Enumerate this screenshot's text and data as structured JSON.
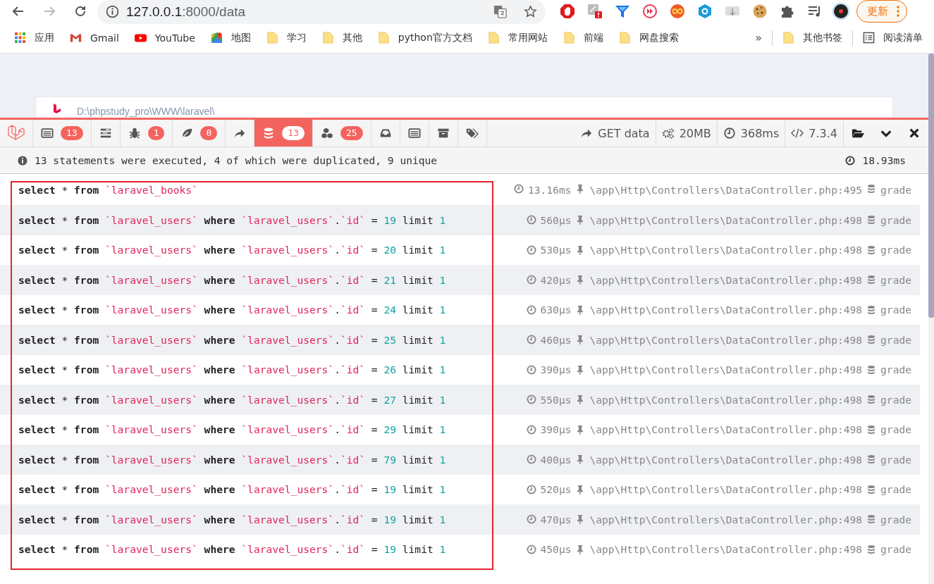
{
  "browser": {
    "navigation": {
      "forward_disabled": true
    },
    "address": {
      "host": "127.0.0.1",
      "path": ":8000/data"
    },
    "update_button": "更新",
    "bookmarks": [
      {
        "kind": "apps",
        "label": "应用"
      },
      {
        "kind": "gmail",
        "label": "Gmail"
      },
      {
        "kind": "youtube",
        "label": "YouTube"
      },
      {
        "kind": "maps",
        "label": "地图"
      },
      {
        "kind": "folder",
        "label": "学习"
      },
      {
        "kind": "folder",
        "label": "其他"
      },
      {
        "kind": "folder",
        "label": "python官方文档"
      },
      {
        "kind": "folder",
        "label": "常用网站"
      },
      {
        "kind": "folder",
        "label": "前端"
      },
      {
        "kind": "folder",
        "label": "网盘搜索"
      }
    ],
    "overflow": "»",
    "other_bookmarks": "其他书签",
    "reading_list": "阅读清单"
  },
  "page": {
    "path": "D:\\phpstudy_pro\\WWW\\laravel\\"
  },
  "debugbar": {
    "tabs": [
      {
        "kind": "messages",
        "badge": "13",
        "selected": false
      },
      {
        "kind": "timeline",
        "selected": false
      },
      {
        "kind": "exceptions",
        "badge": "1",
        "selected": false
      },
      {
        "kind": "views",
        "badge": "0",
        "selected": false
      },
      {
        "kind": "route",
        "selected": false
      },
      {
        "kind": "queries",
        "badge": "13",
        "selected": true
      },
      {
        "kind": "models",
        "badge": "25",
        "selected": false
      },
      {
        "kind": "mails",
        "selected": false
      },
      {
        "kind": "request",
        "selected": false
      },
      {
        "kind": "session",
        "selected": false
      },
      {
        "kind": "tags",
        "selected": false
      }
    ],
    "indicators": [
      {
        "kind": "route",
        "text": "GET data"
      },
      {
        "kind": "memory",
        "text": "20MB"
      },
      {
        "kind": "time",
        "text": "368ms"
      },
      {
        "kind": "php",
        "text": "7.3.4"
      }
    ],
    "controls": [
      {
        "kind": "open"
      },
      {
        "kind": "minimize"
      },
      {
        "kind": "close"
      }
    ],
    "summary": "13 statements were executed, 4 of which were duplicated, 9 unique",
    "total_time": "18.93ms",
    "statements": [
      {
        "sql": [
          {
            "kind": "keyword",
            "text": "select"
          },
          {
            "kind": "plain",
            "text": " * "
          },
          {
            "kind": "keyword",
            "text": "from "
          },
          {
            "kind": "string",
            "text": "`laravel_books`"
          }
        ],
        "duration": "13.16ms",
        "source": "\\app\\Http\\Controllers\\DataController.php:495",
        "connection": "grade"
      },
      {
        "sql": [
          {
            "kind": "keyword",
            "text": "select"
          },
          {
            "kind": "plain",
            "text": " * "
          },
          {
            "kind": "keyword",
            "text": "from "
          },
          {
            "kind": "string",
            "text": "`laravel_users`"
          },
          {
            "kind": "keyword",
            "text": " where "
          },
          {
            "kind": "string",
            "text": "`laravel_users`"
          },
          {
            "kind": "plain",
            "text": "."
          },
          {
            "kind": "string",
            "text": "`id`"
          },
          {
            "kind": "plain",
            "text": " = "
          },
          {
            "kind": "number",
            "text": "19"
          },
          {
            "kind": "plain",
            "text": " limit "
          },
          {
            "kind": "number",
            "text": "1"
          }
        ],
        "duration": "560μs",
        "source": "\\app\\Http\\Controllers\\DataController.php:498",
        "connection": "grade"
      },
      {
        "sql": [
          {
            "kind": "keyword",
            "text": "select"
          },
          {
            "kind": "plain",
            "text": " * "
          },
          {
            "kind": "keyword",
            "text": "from "
          },
          {
            "kind": "string",
            "text": "`laravel_users`"
          },
          {
            "kind": "keyword",
            "text": " where "
          },
          {
            "kind": "string",
            "text": "`laravel_users`"
          },
          {
            "kind": "plain",
            "text": "."
          },
          {
            "kind": "string",
            "text": "`id`"
          },
          {
            "kind": "plain",
            "text": " = "
          },
          {
            "kind": "number",
            "text": "20"
          },
          {
            "kind": "plain",
            "text": " limit "
          },
          {
            "kind": "number",
            "text": "1"
          }
        ],
        "duration": "530μs",
        "source": "\\app\\Http\\Controllers\\DataController.php:498",
        "connection": "grade"
      },
      {
        "sql": [
          {
            "kind": "keyword",
            "text": "select"
          },
          {
            "kind": "plain",
            "text": " * "
          },
          {
            "kind": "keyword",
            "text": "from "
          },
          {
            "kind": "string",
            "text": "`laravel_users`"
          },
          {
            "kind": "keyword",
            "text": " where "
          },
          {
            "kind": "string",
            "text": "`laravel_users`"
          },
          {
            "kind": "plain",
            "text": "."
          },
          {
            "kind": "string",
            "text": "`id`"
          },
          {
            "kind": "plain",
            "text": " = "
          },
          {
            "kind": "number",
            "text": "21"
          },
          {
            "kind": "plain",
            "text": " limit "
          },
          {
            "kind": "number",
            "text": "1"
          }
        ],
        "duration": "420μs",
        "source": "\\app\\Http\\Controllers\\DataController.php:498",
        "connection": "grade"
      },
      {
        "sql": [
          {
            "kind": "keyword",
            "text": "select"
          },
          {
            "kind": "plain",
            "text": " * "
          },
          {
            "kind": "keyword",
            "text": "from "
          },
          {
            "kind": "string",
            "text": "`laravel_users`"
          },
          {
            "kind": "keyword",
            "text": " where "
          },
          {
            "kind": "string",
            "text": "`laravel_users`"
          },
          {
            "kind": "plain",
            "text": "."
          },
          {
            "kind": "string",
            "text": "`id`"
          },
          {
            "kind": "plain",
            "text": " = "
          },
          {
            "kind": "number",
            "text": "24"
          },
          {
            "kind": "plain",
            "text": " limit "
          },
          {
            "kind": "number",
            "text": "1"
          }
        ],
        "duration": "630μs",
        "source": "\\app\\Http\\Controllers\\DataController.php:498",
        "connection": "grade"
      },
      {
        "sql": [
          {
            "kind": "keyword",
            "text": "select"
          },
          {
            "kind": "plain",
            "text": " * "
          },
          {
            "kind": "keyword",
            "text": "from "
          },
          {
            "kind": "string",
            "text": "`laravel_users`"
          },
          {
            "kind": "keyword",
            "text": " where "
          },
          {
            "kind": "string",
            "text": "`laravel_users`"
          },
          {
            "kind": "plain",
            "text": "."
          },
          {
            "kind": "string",
            "text": "`id`"
          },
          {
            "kind": "plain",
            "text": " = "
          },
          {
            "kind": "number",
            "text": "25"
          },
          {
            "kind": "plain",
            "text": " limit "
          },
          {
            "kind": "number",
            "text": "1"
          }
        ],
        "duration": "460μs",
        "source": "\\app\\Http\\Controllers\\DataController.php:498",
        "connection": "grade"
      },
      {
        "sql": [
          {
            "kind": "keyword",
            "text": "select"
          },
          {
            "kind": "plain",
            "text": " * "
          },
          {
            "kind": "keyword",
            "text": "from "
          },
          {
            "kind": "string",
            "text": "`laravel_users`"
          },
          {
            "kind": "keyword",
            "text": " where "
          },
          {
            "kind": "string",
            "text": "`laravel_users`"
          },
          {
            "kind": "plain",
            "text": "."
          },
          {
            "kind": "string",
            "text": "`id`"
          },
          {
            "kind": "plain",
            "text": " = "
          },
          {
            "kind": "number",
            "text": "26"
          },
          {
            "kind": "plain",
            "text": " limit "
          },
          {
            "kind": "number",
            "text": "1"
          }
        ],
        "duration": "390μs",
        "source": "\\app\\Http\\Controllers\\DataController.php:498",
        "connection": "grade"
      },
      {
        "sql": [
          {
            "kind": "keyword",
            "text": "select"
          },
          {
            "kind": "plain",
            "text": " * "
          },
          {
            "kind": "keyword",
            "text": "from "
          },
          {
            "kind": "string",
            "text": "`laravel_users`"
          },
          {
            "kind": "keyword",
            "text": " where "
          },
          {
            "kind": "string",
            "text": "`laravel_users`"
          },
          {
            "kind": "plain",
            "text": "."
          },
          {
            "kind": "string",
            "text": "`id`"
          },
          {
            "kind": "plain",
            "text": " = "
          },
          {
            "kind": "number",
            "text": "27"
          },
          {
            "kind": "plain",
            "text": " limit "
          },
          {
            "kind": "number",
            "text": "1"
          }
        ],
        "duration": "550μs",
        "source": "\\app\\Http\\Controllers\\DataController.php:498",
        "connection": "grade"
      },
      {
        "sql": [
          {
            "kind": "keyword",
            "text": "select"
          },
          {
            "kind": "plain",
            "text": " * "
          },
          {
            "kind": "keyword",
            "text": "from "
          },
          {
            "kind": "string",
            "text": "`laravel_users`"
          },
          {
            "kind": "keyword",
            "text": " where "
          },
          {
            "kind": "string",
            "text": "`laravel_users`"
          },
          {
            "kind": "plain",
            "text": "."
          },
          {
            "kind": "string",
            "text": "`id`"
          },
          {
            "kind": "plain",
            "text": " = "
          },
          {
            "kind": "number",
            "text": "29"
          },
          {
            "kind": "plain",
            "text": " limit "
          },
          {
            "kind": "number",
            "text": "1"
          }
        ],
        "duration": "390μs",
        "source": "\\app\\Http\\Controllers\\DataController.php:498",
        "connection": "grade"
      },
      {
        "sql": [
          {
            "kind": "keyword",
            "text": "select"
          },
          {
            "kind": "plain",
            "text": " * "
          },
          {
            "kind": "keyword",
            "text": "from "
          },
          {
            "kind": "string",
            "text": "`laravel_users`"
          },
          {
            "kind": "keyword",
            "text": " where "
          },
          {
            "kind": "string",
            "text": "`laravel_users`"
          },
          {
            "kind": "plain",
            "text": "."
          },
          {
            "kind": "string",
            "text": "`id`"
          },
          {
            "kind": "plain",
            "text": " = "
          },
          {
            "kind": "number",
            "text": "79"
          },
          {
            "kind": "plain",
            "text": " limit "
          },
          {
            "kind": "number",
            "text": "1"
          }
        ],
        "duration": "400μs",
        "source": "\\app\\Http\\Controllers\\DataController.php:498",
        "connection": "grade"
      },
      {
        "sql": [
          {
            "kind": "keyword",
            "text": "select"
          },
          {
            "kind": "plain",
            "text": " * "
          },
          {
            "kind": "keyword",
            "text": "from "
          },
          {
            "kind": "string",
            "text": "`laravel_users`"
          },
          {
            "kind": "keyword",
            "text": " where "
          },
          {
            "kind": "string",
            "text": "`laravel_users`"
          },
          {
            "kind": "plain",
            "text": "."
          },
          {
            "kind": "string",
            "text": "`id`"
          },
          {
            "kind": "plain",
            "text": " = "
          },
          {
            "kind": "number",
            "text": "19"
          },
          {
            "kind": "plain",
            "text": " limit "
          },
          {
            "kind": "number",
            "text": "1"
          }
        ],
        "duration": "520μs",
        "source": "\\app\\Http\\Controllers\\DataController.php:498",
        "connection": "grade"
      },
      {
        "sql": [
          {
            "kind": "keyword",
            "text": "select"
          },
          {
            "kind": "plain",
            "text": " * "
          },
          {
            "kind": "keyword",
            "text": "from "
          },
          {
            "kind": "string",
            "text": "`laravel_users`"
          },
          {
            "kind": "keyword",
            "text": " where "
          },
          {
            "kind": "string",
            "text": "`laravel_users`"
          },
          {
            "kind": "plain",
            "text": "."
          },
          {
            "kind": "string",
            "text": "`id`"
          },
          {
            "kind": "plain",
            "text": " = "
          },
          {
            "kind": "number",
            "text": "19"
          },
          {
            "kind": "plain",
            "text": " limit "
          },
          {
            "kind": "number",
            "text": "1"
          }
        ],
        "duration": "470μs",
        "source": "\\app\\Http\\Controllers\\DataController.php:498",
        "connection": "grade"
      },
      {
        "sql": [
          {
            "kind": "keyword",
            "text": "select"
          },
          {
            "kind": "plain",
            "text": " * "
          },
          {
            "kind": "keyword",
            "text": "from "
          },
          {
            "kind": "string",
            "text": "`laravel_users`"
          },
          {
            "kind": "keyword",
            "text": " where "
          },
          {
            "kind": "string",
            "text": "`laravel_users`"
          },
          {
            "kind": "plain",
            "text": "."
          },
          {
            "kind": "string",
            "text": "`id`"
          },
          {
            "kind": "plain",
            "text": " = "
          },
          {
            "kind": "number",
            "text": "19"
          },
          {
            "kind": "plain",
            "text": " limit "
          },
          {
            "kind": "number",
            "text": "1"
          }
        ],
        "duration": "450μs",
        "source": "\\app\\Http\\Controllers\\DataController.php:498",
        "connection": "grade"
      }
    ]
  }
}
